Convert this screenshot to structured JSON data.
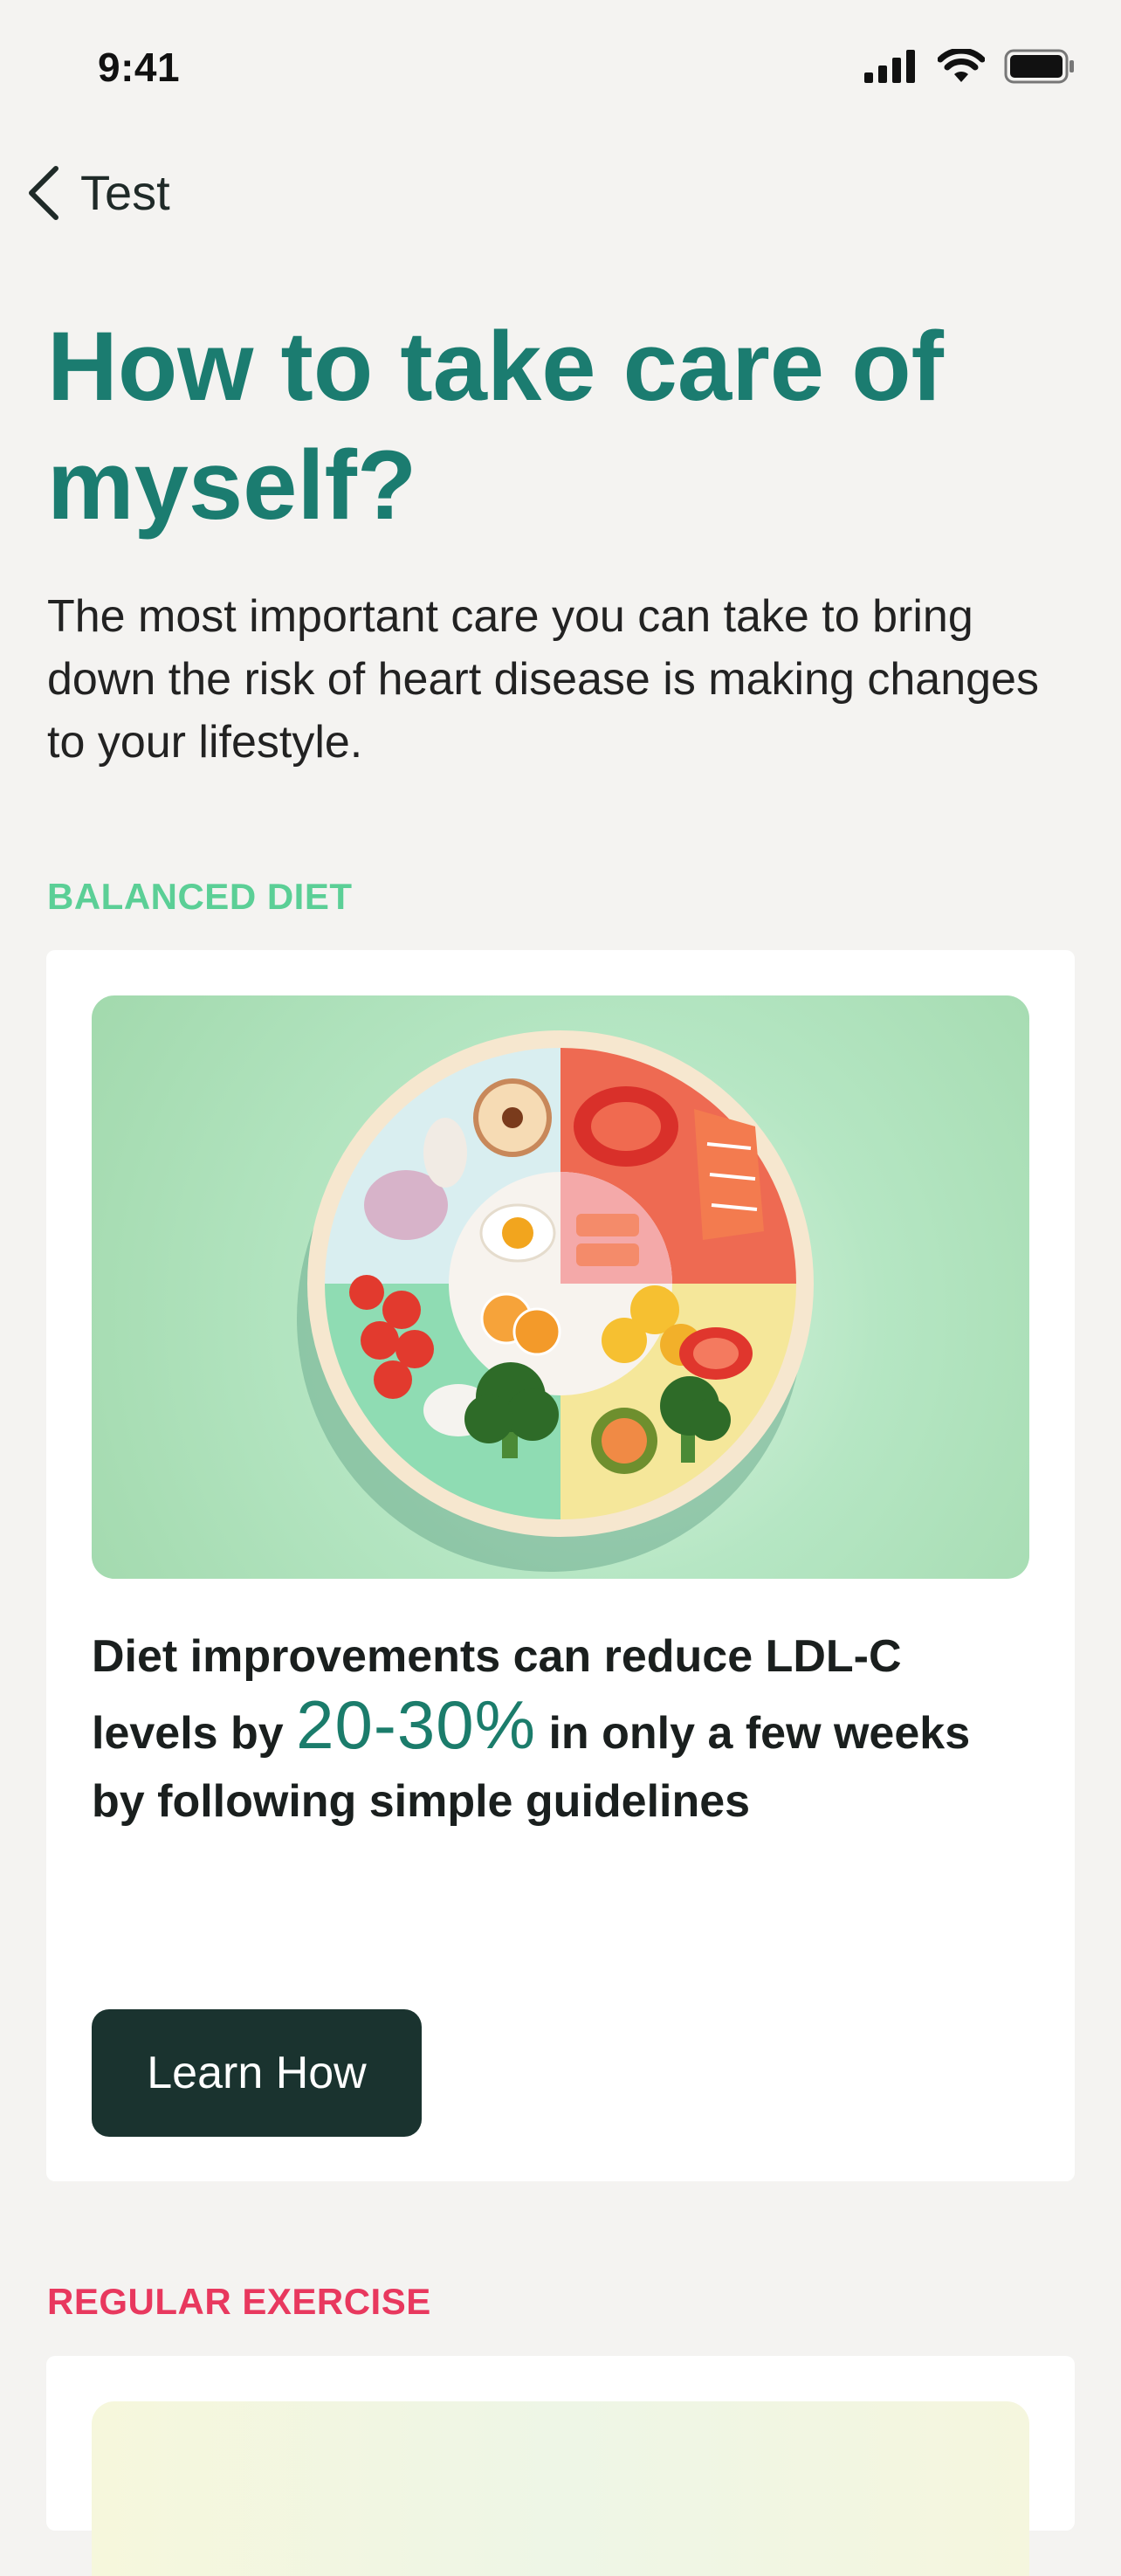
{
  "status_bar": {
    "time": "9:41",
    "icons": [
      "signal-icon",
      "wifi-icon",
      "battery-icon"
    ]
  },
  "nav": {
    "back_label": "Test"
  },
  "header": {
    "title": "How to take care of myself?",
    "intro": "The most important care you can take to bring down the risk of heart disease is making changes to your lifestyle."
  },
  "sections": {
    "diet": {
      "label": "BALANCED DIET",
      "image": "healthy-plate-illustration",
      "text_before": "Diet improvements can reduce LDL-C levels by",
      "stat": "20-30%",
      "text_after": "in only a few weeks by following simple guidelines",
      "button_label": "Learn How"
    },
    "exercise": {
      "label": "REGULAR EXERCISE"
    }
  },
  "colors": {
    "background": "#f4f3f1",
    "title": "#1b7c70",
    "diet_label": "#5bcf96",
    "exercise_label": "#e8385e",
    "button": "#1a332f",
    "stat": "#1b7c6b"
  }
}
